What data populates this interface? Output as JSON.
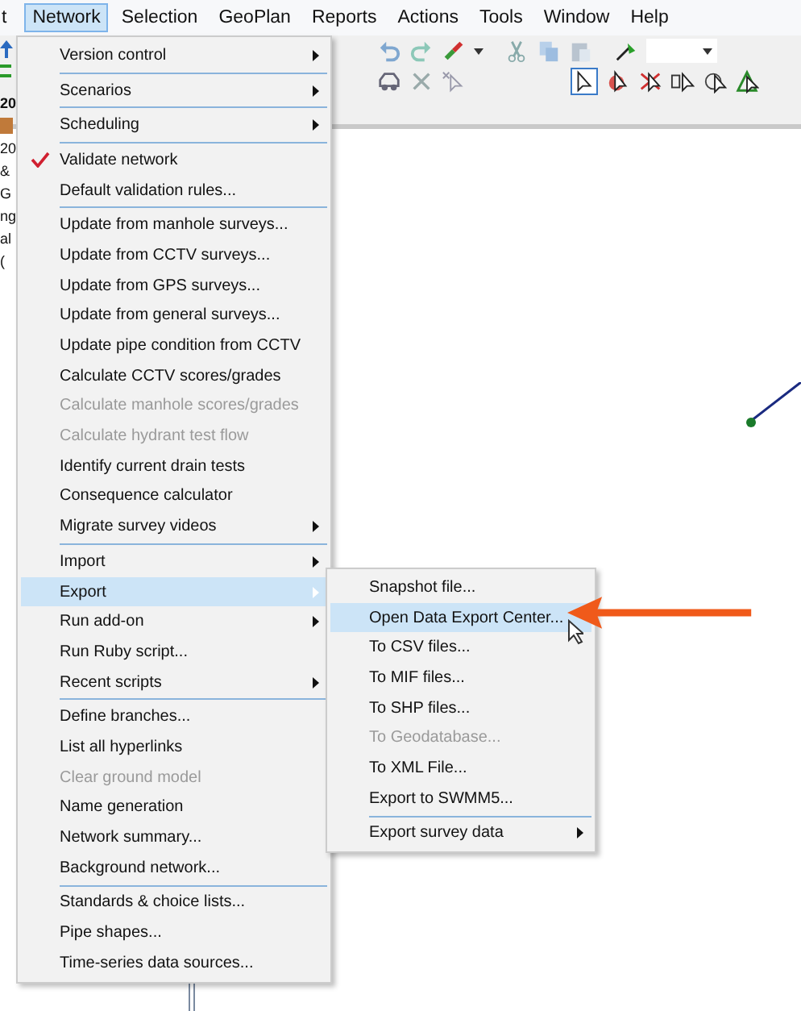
{
  "menubar": [
    {
      "label": "t",
      "selected": false
    },
    {
      "label": "Network",
      "selected": true
    },
    {
      "label": "Selection",
      "selected": false
    },
    {
      "label": "GeoPlan",
      "selected": false
    },
    {
      "label": "Reports",
      "selected": false
    },
    {
      "label": "Actions",
      "selected": false
    },
    {
      "label": "Tools",
      "selected": false
    },
    {
      "label": "Window",
      "selected": false
    },
    {
      "label": "Help",
      "selected": false
    }
  ],
  "left_panel": {
    "texts": [
      "20",
      "20",
      "&",
      "G",
      "ng",
      "al",
      "("
    ]
  },
  "network_menu": {
    "items": [
      {
        "label": "Version control",
        "submenu": true,
        "disabled": false,
        "checked": false,
        "selected": false,
        "divider_after": true
      },
      {
        "label": "Scenarios",
        "submenu": true,
        "disabled": false,
        "checked": false,
        "selected": false,
        "divider_after": true
      },
      {
        "label": "Scheduling",
        "submenu": true,
        "disabled": false,
        "checked": false,
        "selected": false,
        "divider_after": true
      },
      {
        "label": "Validate network",
        "submenu": false,
        "disabled": false,
        "checked": true,
        "selected": false,
        "divider_after": false
      },
      {
        "label": "Default validation rules...",
        "submenu": false,
        "disabled": false,
        "checked": false,
        "selected": false,
        "divider_after": true
      },
      {
        "label": "Update from manhole surveys...",
        "submenu": false,
        "disabled": false,
        "checked": false,
        "selected": false,
        "divider_after": false
      },
      {
        "label": "Update from CCTV surveys...",
        "submenu": false,
        "disabled": false,
        "checked": false,
        "selected": false,
        "divider_after": false
      },
      {
        "label": "Update from GPS surveys...",
        "submenu": false,
        "disabled": false,
        "checked": false,
        "selected": false,
        "divider_after": false
      },
      {
        "label": "Update from general surveys...",
        "submenu": false,
        "disabled": false,
        "checked": false,
        "selected": false,
        "divider_after": false
      },
      {
        "label": "Update pipe condition from CCTV",
        "submenu": false,
        "disabled": false,
        "checked": false,
        "selected": false,
        "divider_after": false
      },
      {
        "label": "Calculate CCTV scores/grades",
        "submenu": false,
        "disabled": false,
        "checked": false,
        "selected": false,
        "divider_after": false
      },
      {
        "label": "Calculate manhole scores/grades",
        "submenu": false,
        "disabled": true,
        "checked": false,
        "selected": false,
        "divider_after": false
      },
      {
        "label": "Calculate hydrant test flow",
        "submenu": false,
        "disabled": true,
        "checked": false,
        "selected": false,
        "divider_after": false
      },
      {
        "label": "Identify current drain tests",
        "submenu": false,
        "disabled": false,
        "checked": false,
        "selected": false,
        "divider_after": false
      },
      {
        "label": "Consequence calculator",
        "submenu": false,
        "disabled": false,
        "checked": false,
        "selected": false,
        "divider_after": false
      },
      {
        "label": "Migrate survey videos",
        "submenu": true,
        "disabled": false,
        "checked": false,
        "selected": false,
        "divider_after": true
      },
      {
        "label": "Import",
        "submenu": true,
        "disabled": false,
        "checked": false,
        "selected": false,
        "divider_after": false
      },
      {
        "label": "Export",
        "submenu": true,
        "disabled": false,
        "checked": false,
        "selected": true,
        "divider_after": false
      },
      {
        "label": "Run add-on",
        "submenu": true,
        "disabled": false,
        "checked": false,
        "selected": false,
        "divider_after": false
      },
      {
        "label": "Run Ruby script...",
        "submenu": false,
        "disabled": false,
        "checked": false,
        "selected": false,
        "divider_after": false
      },
      {
        "label": "Recent scripts",
        "submenu": true,
        "disabled": false,
        "checked": false,
        "selected": false,
        "divider_after": true
      },
      {
        "label": "Define branches...",
        "submenu": false,
        "disabled": false,
        "checked": false,
        "selected": false,
        "divider_after": false
      },
      {
        "label": "List all hyperlinks",
        "submenu": false,
        "disabled": false,
        "checked": false,
        "selected": false,
        "divider_after": false
      },
      {
        "label": "Clear ground model",
        "submenu": false,
        "disabled": true,
        "checked": false,
        "selected": false,
        "divider_after": false
      },
      {
        "label": "Name generation",
        "submenu": false,
        "disabled": false,
        "checked": false,
        "selected": false,
        "divider_after": false
      },
      {
        "label": "Network summary...",
        "submenu": false,
        "disabled": false,
        "checked": false,
        "selected": false,
        "divider_after": false
      },
      {
        "label": "Background network...",
        "submenu": false,
        "disabled": false,
        "checked": false,
        "selected": false,
        "divider_after": true
      },
      {
        "label": "Standards & choice lists...",
        "submenu": false,
        "disabled": false,
        "checked": false,
        "selected": false,
        "divider_after": false
      },
      {
        "label": "Pipe shapes...",
        "submenu": false,
        "disabled": false,
        "checked": false,
        "selected": false,
        "divider_after": false
      },
      {
        "label": "Time-series data sources...",
        "submenu": false,
        "disabled": false,
        "checked": false,
        "selected": false,
        "divider_after": false
      }
    ]
  },
  "export_submenu": {
    "items": [
      {
        "label": "Snapshot file...",
        "submenu": false,
        "disabled": false,
        "selected": false,
        "divider_after": false
      },
      {
        "label": "Open Data Export Center...",
        "submenu": false,
        "disabled": false,
        "selected": true,
        "divider_after": false
      },
      {
        "label": "To CSV files...",
        "submenu": false,
        "disabled": false,
        "selected": false,
        "divider_after": false
      },
      {
        "label": "To MIF files...",
        "submenu": false,
        "disabled": false,
        "selected": false,
        "divider_after": false
      },
      {
        "label": "To SHP files...",
        "submenu": false,
        "disabled": false,
        "selected": false,
        "divider_after": false
      },
      {
        "label": "To Geodatabase...",
        "submenu": false,
        "disabled": true,
        "selected": false,
        "divider_after": false
      },
      {
        "label": "To XML File...",
        "submenu": false,
        "disabled": false,
        "selected": false,
        "divider_after": false
      },
      {
        "label": "Export to SWMM5...",
        "submenu": false,
        "disabled": false,
        "selected": false,
        "divider_after": true
      },
      {
        "label": "Export survey data",
        "submenu": true,
        "disabled": false,
        "selected": false,
        "divider_after": false
      }
    ]
  }
}
